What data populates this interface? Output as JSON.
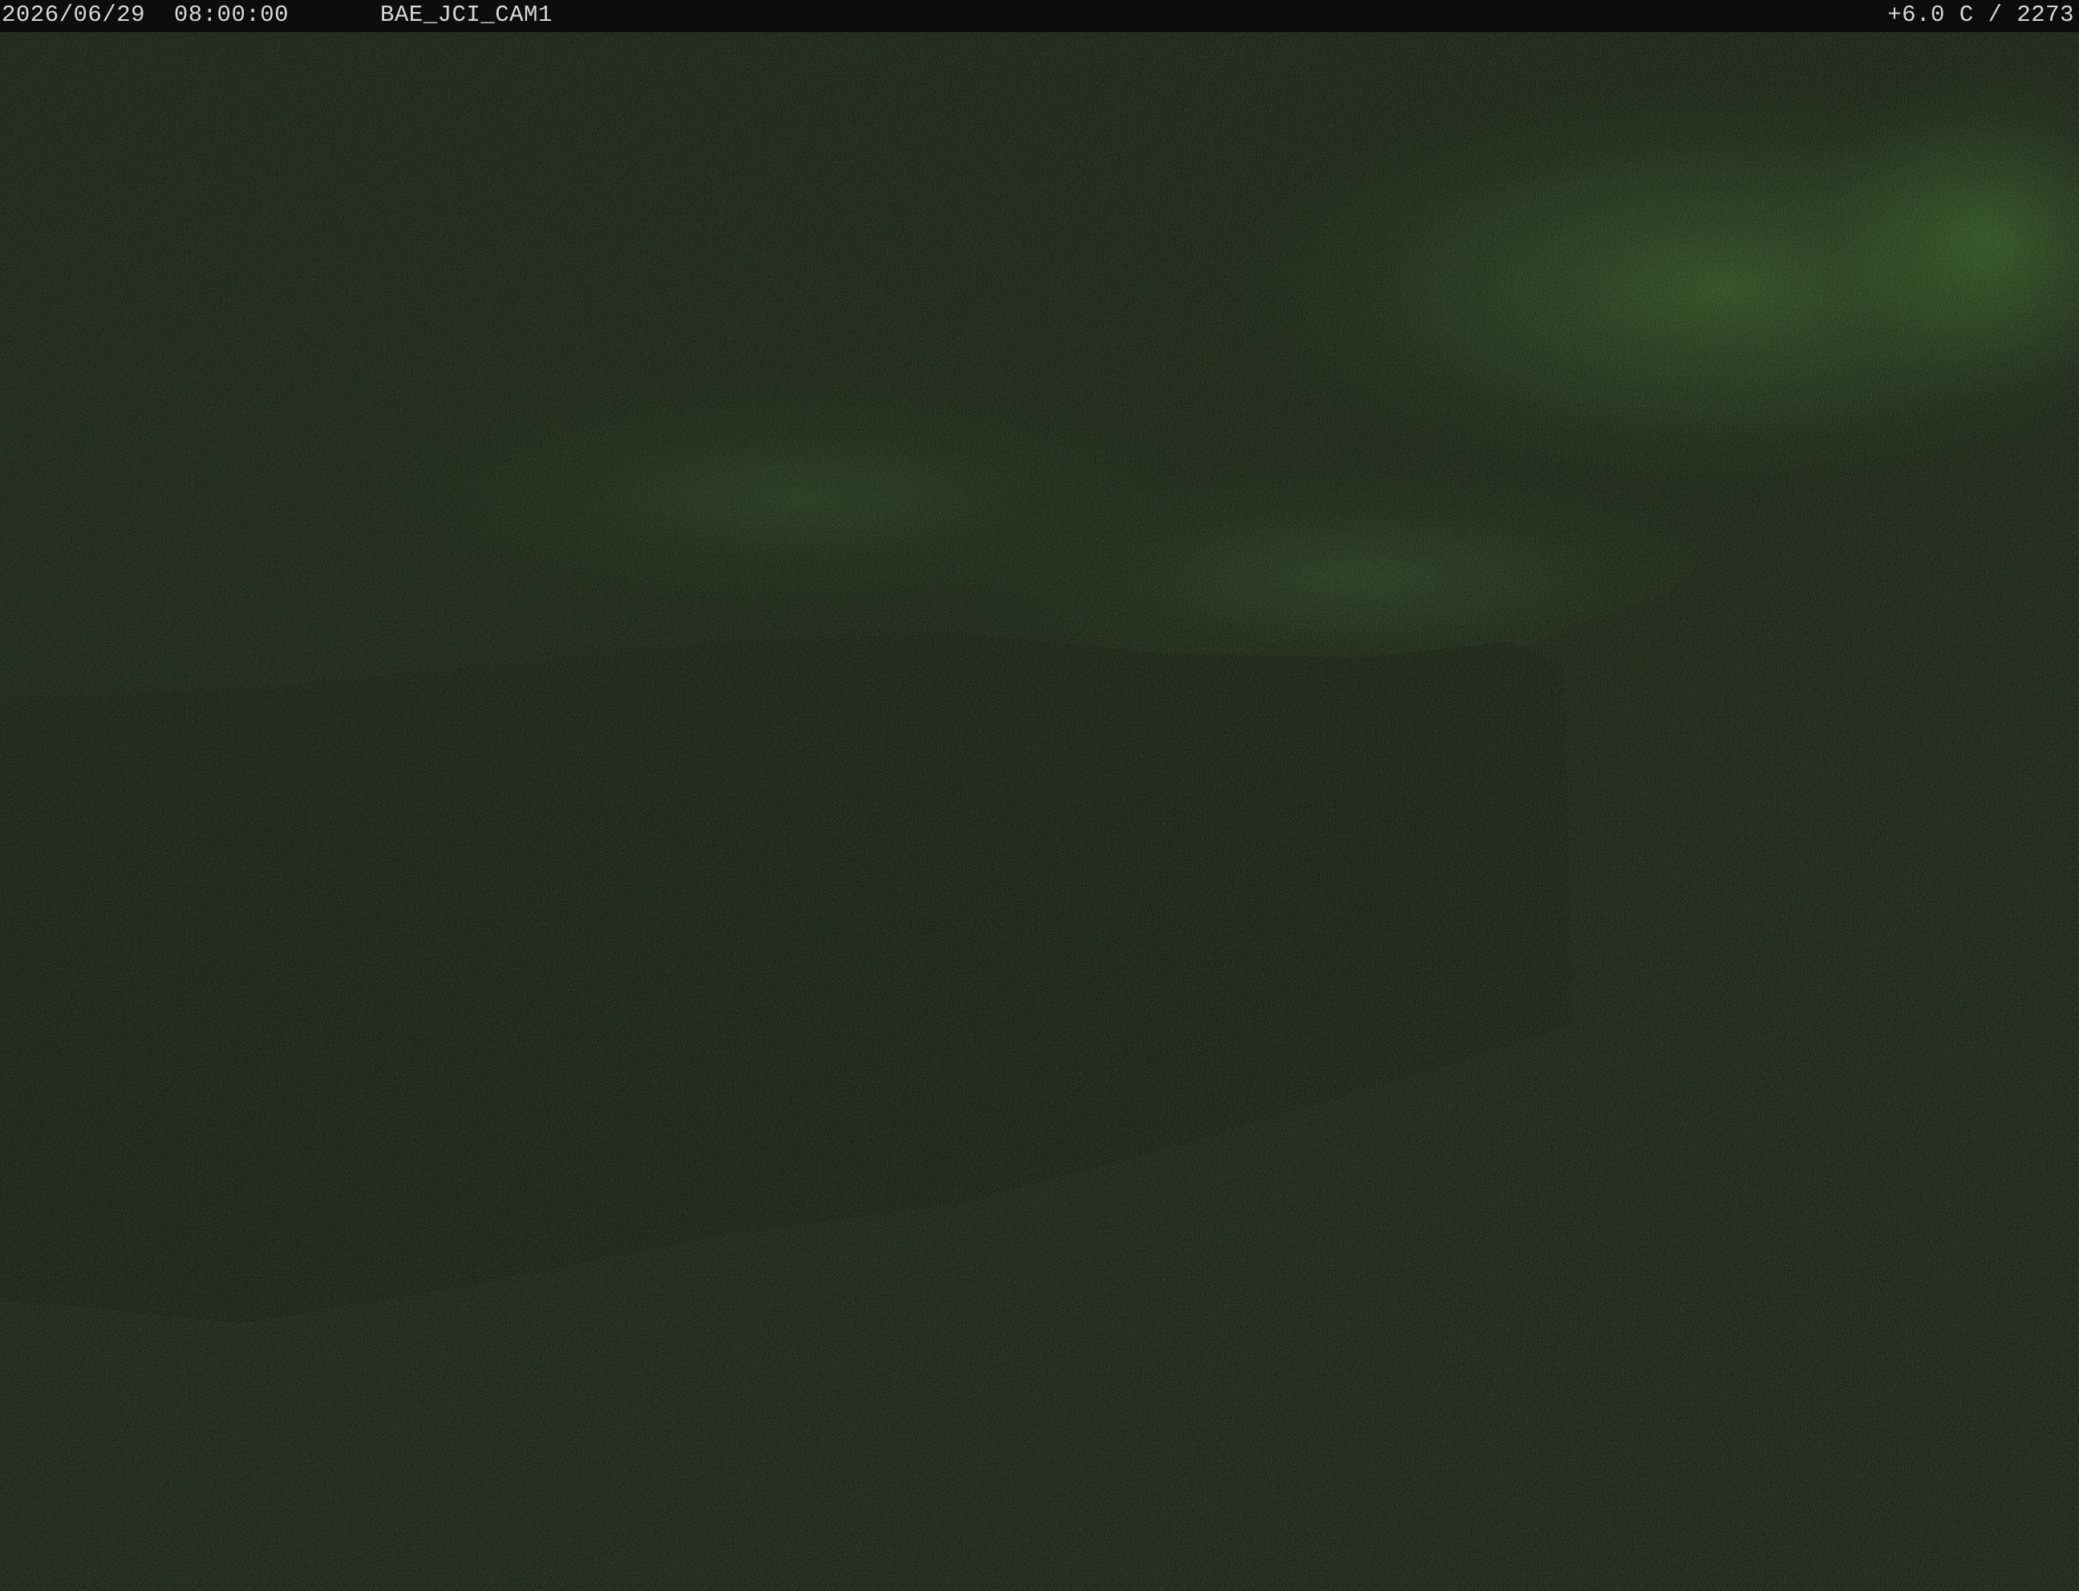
{
  "overlay": {
    "datetime": "2026/06/29  08:00:00",
    "camera_id": "BAE_JCI_CAM1",
    "sensor_readout": "+6.0 C / 2273"
  },
  "scene": {
    "description_colors": {
      "sky": "#141515",
      "aurora_glow": "#2f5a2a",
      "hillside": "#161616",
      "foreground": "#141414",
      "overlay_text": "#d8d8d8",
      "overlay_bar": "#0d0d0d"
    }
  }
}
